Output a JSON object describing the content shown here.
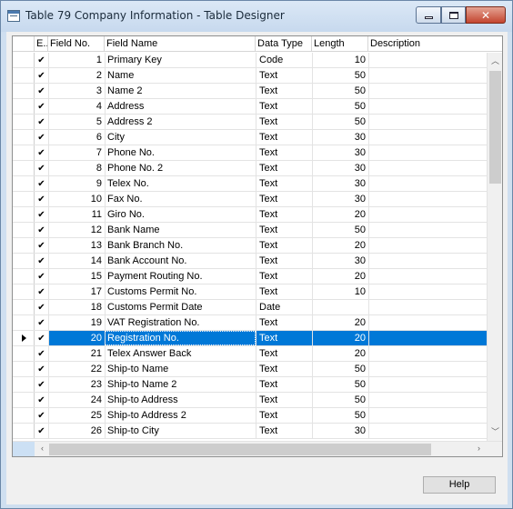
{
  "window": {
    "title": "Table 79 Company Information - Table Designer"
  },
  "columns": {
    "enabled": "E...",
    "field_no": "Field No.",
    "field_name": "Field Name",
    "data_type": "Data Type",
    "length": "Length",
    "description": "Description"
  },
  "rows": [
    {
      "no": "1",
      "name": "Primary Key",
      "type": "Code",
      "len": "10"
    },
    {
      "no": "2",
      "name": "Name",
      "type": "Text",
      "len": "50"
    },
    {
      "no": "3",
      "name": "Name 2",
      "type": "Text",
      "len": "50"
    },
    {
      "no": "4",
      "name": "Address",
      "type": "Text",
      "len": "50"
    },
    {
      "no": "5",
      "name": "Address 2",
      "type": "Text",
      "len": "50"
    },
    {
      "no": "6",
      "name": "City",
      "type": "Text",
      "len": "30"
    },
    {
      "no": "7",
      "name": "Phone No.",
      "type": "Text",
      "len": "30"
    },
    {
      "no": "8",
      "name": "Phone No. 2",
      "type": "Text",
      "len": "30"
    },
    {
      "no": "9",
      "name": "Telex No.",
      "type": "Text",
      "len": "30"
    },
    {
      "no": "10",
      "name": "Fax No.",
      "type": "Text",
      "len": "30"
    },
    {
      "no": "11",
      "name": "Giro No.",
      "type": "Text",
      "len": "20"
    },
    {
      "no": "12",
      "name": "Bank Name",
      "type": "Text",
      "len": "50"
    },
    {
      "no": "13",
      "name": "Bank Branch No.",
      "type": "Text",
      "len": "20"
    },
    {
      "no": "14",
      "name": "Bank Account No.",
      "type": "Text",
      "len": "30"
    },
    {
      "no": "15",
      "name": "Payment Routing No.",
      "type": "Text",
      "len": "20"
    },
    {
      "no": "17",
      "name": "Customs Permit No.",
      "type": "Text",
      "len": "10"
    },
    {
      "no": "18",
      "name": "Customs Permit Date",
      "type": "Date",
      "len": ""
    },
    {
      "no": "19",
      "name": "VAT Registration No.",
      "type": "Text",
      "len": "20"
    },
    {
      "no": "20",
      "name": "Registration No.",
      "type": "Text",
      "len": "20",
      "selected": true
    },
    {
      "no": "21",
      "name": "Telex Answer Back",
      "type": "Text",
      "len": "20"
    },
    {
      "no": "22",
      "name": "Ship-to Name",
      "type": "Text",
      "len": "50"
    },
    {
      "no": "23",
      "name": "Ship-to Name 2",
      "type": "Text",
      "len": "50"
    },
    {
      "no": "24",
      "name": "Ship-to Address",
      "type": "Text",
      "len": "50"
    },
    {
      "no": "25",
      "name": "Ship-to Address 2",
      "type": "Text",
      "len": "50"
    },
    {
      "no": "26",
      "name": "Ship-to City",
      "type": "Text",
      "len": "30"
    }
  ],
  "buttons": {
    "help": "Help"
  },
  "icons": {
    "check": "check-icon",
    "row_pointer": "row-pointer-icon",
    "scroll_up": "chevron-up-icon",
    "scroll_down": "chevron-down-icon",
    "scroll_left": "chevron-left-icon",
    "scroll_right": "chevron-right-icon"
  },
  "colors": {
    "selection": "#0078d7",
    "titlebar": "#cfdff0",
    "close_button": "#c4452f"
  }
}
